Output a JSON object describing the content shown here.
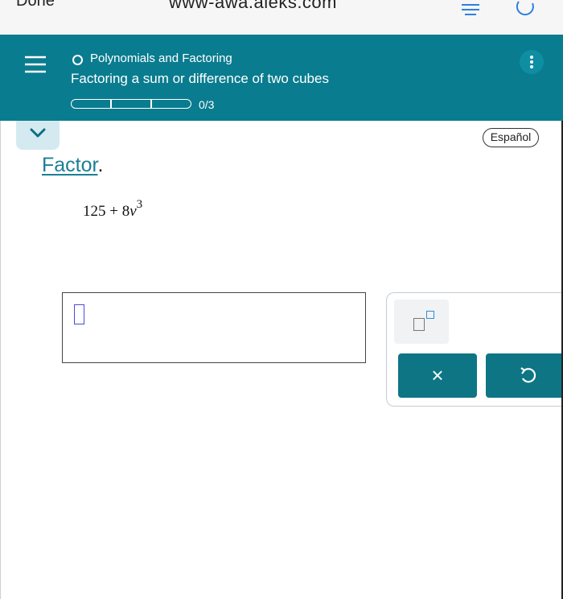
{
  "browser": {
    "done_label": "Done",
    "url": "www-awa.aleks.com",
    "icons": [
      "reader-icon",
      "reload-icon"
    ]
  },
  "header": {
    "topic": "Polynomials and Factoring",
    "lesson": "Factoring a sum or difference of two cubes",
    "progress_text": "0/3",
    "progress_fraction": 0,
    "background_color": "#0a7c8f",
    "icons": [
      "menu-icon",
      "more-vertical-icon"
    ]
  },
  "language_button": "Español",
  "problem": {
    "instruction": "Factor",
    "instruction_period": ".",
    "expression_constant": "125",
    "expression_operator": "+",
    "expression_coefficient": "8",
    "expression_variable": "v",
    "expression_exponent": "3"
  },
  "keypad": {
    "clear_label": "×",
    "icons": [
      "exponent-template-icon",
      "undo-icon"
    ],
    "accent_color": "#0e7585"
  }
}
